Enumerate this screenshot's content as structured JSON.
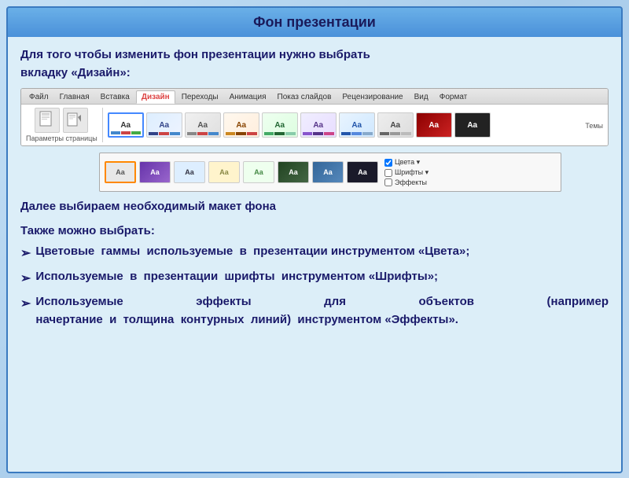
{
  "title": "Фон презентации",
  "intro": {
    "line1": "Для  того  чтобы  изменить  фон  презентации  нужно  выбрать",
    "line2": "вкладку «Дизайн»:"
  },
  "ribbon": {
    "tabs": [
      "Файл",
      "Главная",
      "Вставка",
      "Дизайн",
      "Переходы",
      "Анимация",
      "Показ слайдов",
      "Рецензирование",
      "Вид",
      "Формат"
    ],
    "active_tab": "Дизайн",
    "groups": {
      "left_label": "Параметры страницы",
      "theme_label": "Темы"
    }
  },
  "body": {
    "section1": "Далее выбираем необходимый макет фона",
    "section2": "Также можно выбрать:",
    "bullets": [
      "Цветовые  гаммы  используемые  в  презентации инструментом «Цвета»;",
      "Используемые  в  презентации  шрифты  инструментом «Шрифты»;",
      "Используемые  эффекты  для  объектов  (например начертание  и  толщина  контурных  линий)  инструментом «Эффекты»."
    ],
    "side_options": [
      "Цвета ▾",
      "Шрифты ▾",
      "Эффекты"
    ]
  }
}
